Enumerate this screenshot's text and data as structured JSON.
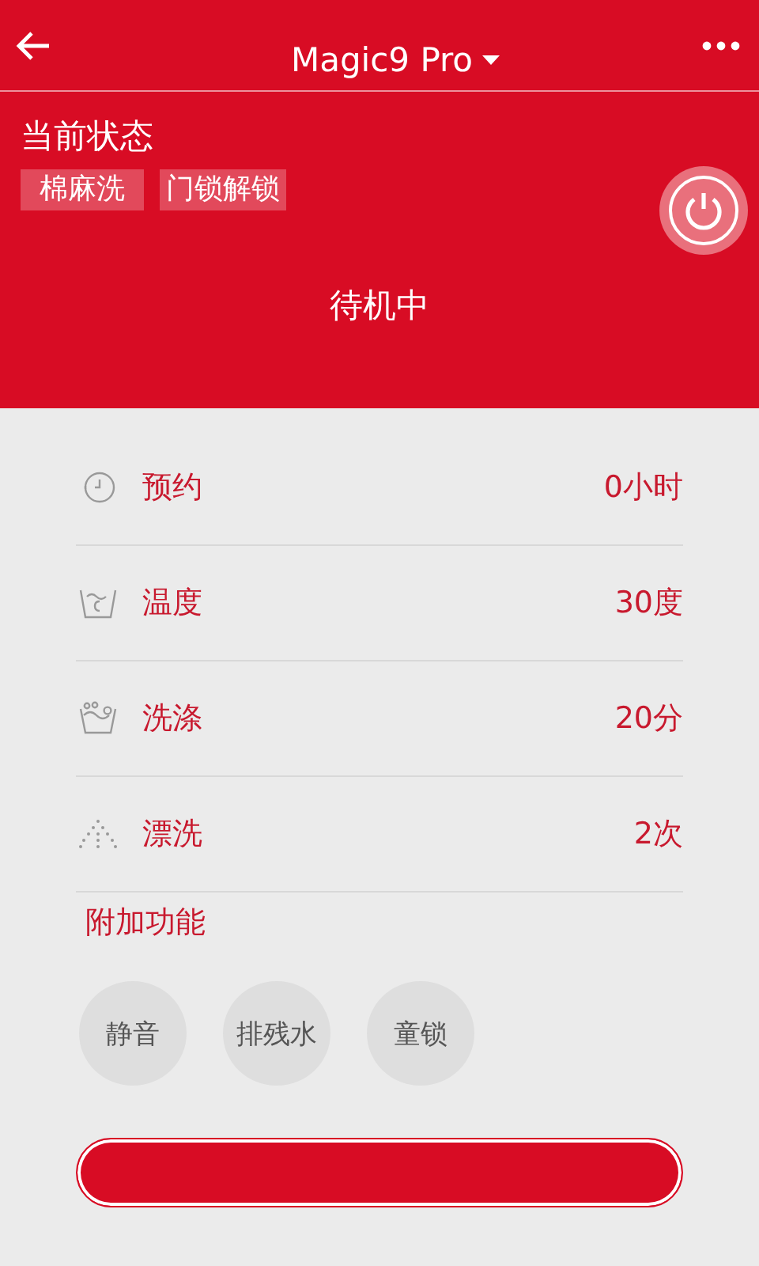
{
  "header": {
    "title": "Magic9 Pro"
  },
  "status": {
    "heading": "当前状态",
    "tags": [
      "棉麻洗",
      "门锁解锁"
    ],
    "state": "待机中"
  },
  "settings": [
    {
      "kind": "timer",
      "label": "预约",
      "value": "0小时"
    },
    {
      "kind": "temperature",
      "label": "温度",
      "value": "30度"
    },
    {
      "kind": "wash",
      "label": "洗涤",
      "value": "20分"
    },
    {
      "kind": "rinse",
      "label": "漂洗",
      "value": "2次"
    }
  ],
  "extras": {
    "heading": "附加功能",
    "options": [
      "静音",
      "排残水",
      "童锁"
    ]
  }
}
